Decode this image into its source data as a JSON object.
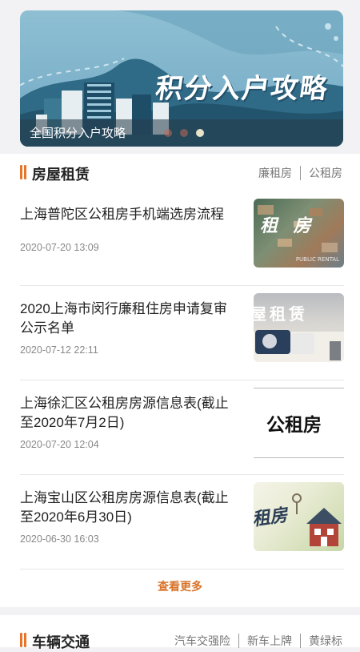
{
  "banner": {
    "title": "积分入户攻略",
    "caption": "全国积分入户攻略",
    "dots_count": 3,
    "active_dot": 2
  },
  "section_rent": {
    "title": "房屋租赁",
    "links": [
      "廉租房",
      "公租房"
    ],
    "items": [
      {
        "title": "上海普陀区公租房手机端选房流程",
        "date": "2020-07-20 13:09",
        "thumb_text": "租 房",
        "thumb_subtext": "PUBLIC RENTAL"
      },
      {
        "title": "2020上海市闵行廉租住房申请复审公示名单",
        "date": "2020-07-12 22:11",
        "thumb_text": "屋租赁"
      },
      {
        "title": "上海徐汇区公租房房源信息表(截止至2020年7月2日)",
        "date": "2020-07-20 12:04",
        "thumb_text": "公租房"
      },
      {
        "title": "上海宝山区公租房房源信息表(截止至2020年6月30日)",
        "date": "2020-06-30 16:03",
        "thumb_text": "租房"
      }
    ],
    "more_label": "查看更多"
  },
  "section_car": {
    "title": "车辆交通",
    "links": [
      "汽车交强险",
      "新车上牌",
      "黄绿标"
    ]
  },
  "colors": {
    "accent": "#e8742a",
    "more_link": "#d8742a",
    "banner_bg": "#8ebfd3"
  }
}
